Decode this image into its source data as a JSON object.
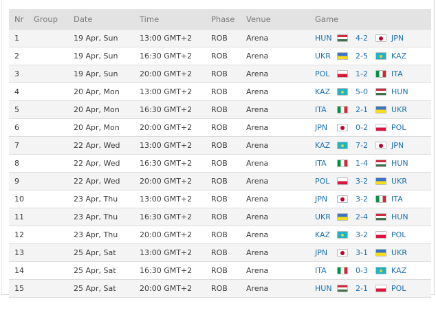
{
  "columns": [
    "Nr",
    "Group",
    "Date",
    "Time",
    "Phase",
    "Venue",
    "Game"
  ],
  "colors": {
    "header_bg": "#e3e3e3",
    "odd_row": "#f4f4f4",
    "even_row": "#ffffff",
    "link": "#1a6fb3"
  },
  "rows": [
    {
      "nr": "1",
      "group": "",
      "date": "19 Apr, Sun",
      "time": "13:00 GMT+2",
      "phase": "ROB",
      "venue": "Arena",
      "home": "HUN",
      "home_flag": "hun",
      "score": "4-2",
      "away": "JPN",
      "away_flag": "jpn"
    },
    {
      "nr": "2",
      "group": "",
      "date": "19 Apr, Sun",
      "time": "16:30 GMT+2",
      "phase": "ROB",
      "venue": "Arena",
      "home": "UKR",
      "home_flag": "ukr",
      "score": "2-5",
      "away": "KAZ",
      "away_flag": "kaz"
    },
    {
      "nr": "3",
      "group": "",
      "date": "19 Apr, Sun",
      "time": "20:00 GMT+2",
      "phase": "ROB",
      "venue": "Arena",
      "home": "POL",
      "home_flag": "pol",
      "score": "1-2",
      "away": "ITA",
      "away_flag": "ita"
    },
    {
      "nr": "4",
      "group": "",
      "date": "20 Apr, Mon",
      "time": "13:00 GMT+2",
      "phase": "ROB",
      "venue": "Arena",
      "home": "KAZ",
      "home_flag": "kaz",
      "score": "5-0",
      "away": "HUN",
      "away_flag": "hun"
    },
    {
      "nr": "5",
      "group": "",
      "date": "20 Apr, Mon",
      "time": "16:30 GMT+2",
      "phase": "ROB",
      "venue": "Arena",
      "home": "ITA",
      "home_flag": "ita",
      "score": "2-1",
      "away": "UKR",
      "away_flag": "ukr"
    },
    {
      "nr": "6",
      "group": "",
      "date": "20 Apr, Mon",
      "time": "20:00 GMT+2",
      "phase": "ROB",
      "venue": "Arena",
      "home": "JPN",
      "home_flag": "jpn",
      "score": "0-2",
      "away": "POL",
      "away_flag": "pol"
    },
    {
      "nr": "7",
      "group": "",
      "date": "22 Apr, Wed",
      "time": "13:00 GMT+2",
      "phase": "ROB",
      "venue": "Arena",
      "home": "KAZ",
      "home_flag": "kaz",
      "score": "7-2",
      "away": "JPN",
      "away_flag": "jpn"
    },
    {
      "nr": "8",
      "group": "",
      "date": "22 Apr, Wed",
      "time": "16:30 GMT+2",
      "phase": "ROB",
      "venue": "Arena",
      "home": "ITA",
      "home_flag": "ita",
      "score": "1-4",
      "away": "HUN",
      "away_flag": "hun"
    },
    {
      "nr": "9",
      "group": "",
      "date": "22 Apr, Wed",
      "time": "20:00 GMT+2",
      "phase": "ROB",
      "venue": "Arena",
      "home": "POL",
      "home_flag": "pol",
      "score": "3-2",
      "away": "UKR",
      "away_flag": "ukr"
    },
    {
      "nr": "10",
      "group": "",
      "date": "23 Apr, Thu",
      "time": "13:00 GMT+2",
      "phase": "ROB",
      "venue": "Arena",
      "home": "JPN",
      "home_flag": "jpn",
      "score": "3-2",
      "away": "ITA",
      "away_flag": "ita"
    },
    {
      "nr": "11",
      "group": "",
      "date": "23 Apr, Thu",
      "time": "16:30 GMT+2",
      "phase": "ROB",
      "venue": "Arena",
      "home": "UKR",
      "home_flag": "ukr",
      "score": "2-4",
      "away": "HUN",
      "away_flag": "hun"
    },
    {
      "nr": "12",
      "group": "",
      "date": "23 Apr, Thu",
      "time": "20:00 GMT+2",
      "phase": "ROB",
      "venue": "Arena",
      "home": "KAZ",
      "home_flag": "kaz",
      "score": "3-2",
      "away": "POL",
      "away_flag": "pol"
    },
    {
      "nr": "13",
      "group": "",
      "date": "25 Apr, Sat",
      "time": "13:00 GMT+2",
      "phase": "ROB",
      "venue": "Arena",
      "home": "JPN",
      "home_flag": "jpn",
      "score": "3-1",
      "away": "UKR",
      "away_flag": "ukr"
    },
    {
      "nr": "14",
      "group": "",
      "date": "25 Apr, Sat",
      "time": "16:30 GMT+2",
      "phase": "ROB",
      "venue": "Arena",
      "home": "ITA",
      "home_flag": "ita",
      "score": "0-3",
      "away": "KAZ",
      "away_flag": "kaz"
    },
    {
      "nr": "15",
      "group": "",
      "date": "25 Apr, Sat",
      "time": "20:00 GMT+2",
      "phase": "ROB",
      "venue": "Arena",
      "home": "HUN",
      "home_flag": "hun",
      "score": "2-1",
      "away": "POL",
      "away_flag": "pol"
    }
  ]
}
